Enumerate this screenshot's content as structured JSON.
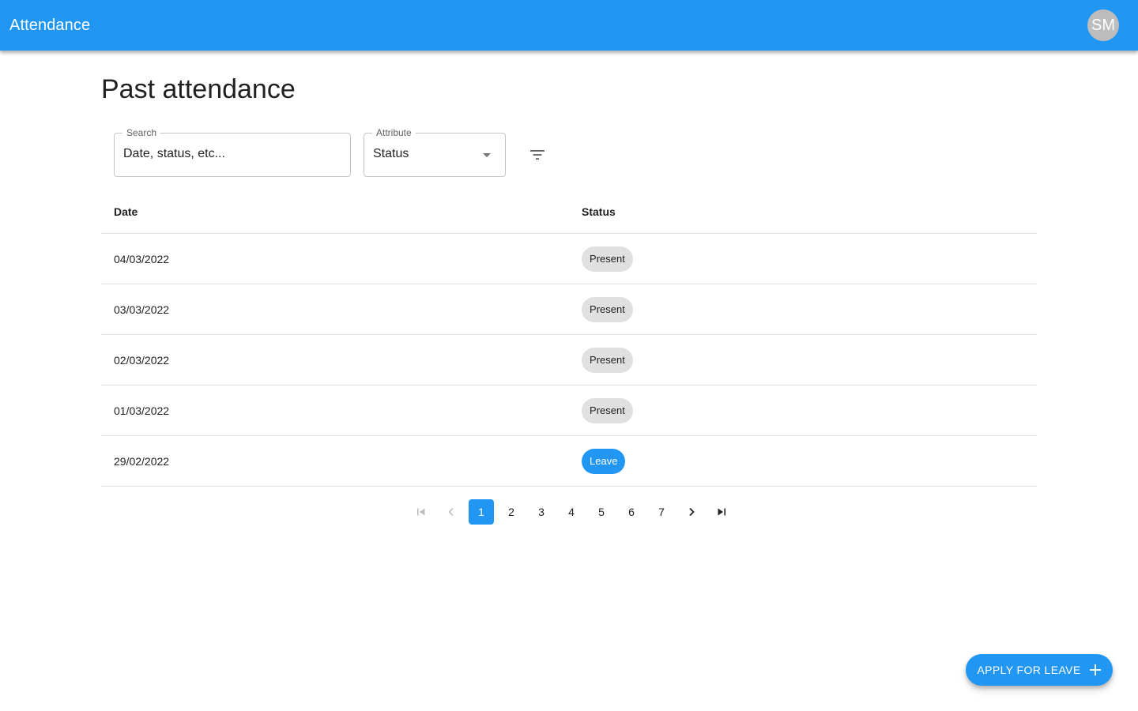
{
  "appbar": {
    "title": "Attendance",
    "avatar_initials": "SM"
  },
  "page": {
    "title": "Past attendance"
  },
  "filters": {
    "search": {
      "label": "Search",
      "placeholder": "Date, status, etc..."
    },
    "attribute": {
      "label": "Attribute",
      "value": "Status"
    },
    "filter_icon": "filter-list-icon"
  },
  "table": {
    "headers": {
      "date": "Date",
      "status": "Status"
    },
    "rows": [
      {
        "date": "04/03/2022",
        "status": "Present"
      },
      {
        "date": "03/03/2022",
        "status": "Present"
      },
      {
        "date": "02/03/2022",
        "status": "Present"
      },
      {
        "date": "01/03/2022",
        "status": "Present"
      },
      {
        "date": "29/02/2022",
        "status": "Leave"
      }
    ]
  },
  "pagination": {
    "current": 1,
    "pages": [
      "1",
      "2",
      "3",
      "4",
      "5",
      "6",
      "7"
    ]
  },
  "fab": {
    "label": "APPLY FOR LEAVE",
    "icon": "plus-icon"
  },
  "colors": {
    "primary": "#2196f3",
    "chip_default": "#e0e0e0",
    "avatar": "#bdbdbd"
  }
}
